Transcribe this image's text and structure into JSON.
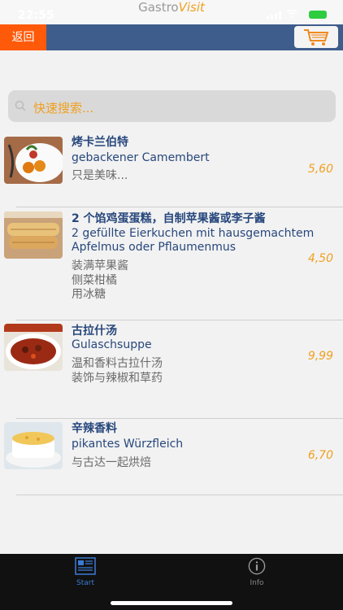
{
  "status_bar": {
    "time": "22:55",
    "brand_part1": "Gastro",
    "brand_part2": "Visit"
  },
  "nav": {
    "back_label": "返回",
    "cart_icon": "shopping-cart-icon"
  },
  "search": {
    "placeholder": "快速搜索..."
  },
  "menu": {
    "items": [
      {
        "name": "烤卡兰伯特",
        "subtitle": "gebackener Camembert",
        "desc1": "只是美味...",
        "desc2": "",
        "desc3": "",
        "price": "5,60"
      },
      {
        "name": "2 个馅鸡蛋蛋糕，自制苹果酱或李子酱",
        "subtitle": "2 gefüllte Eierkuchen mit hausgemachtem Apfelmus oder Pflaumenmus",
        "desc1": "装满苹果酱",
        "desc2": "侧菜柑橘",
        "desc3": "用冰糖",
        "price": "4,50"
      },
      {
        "name": "古拉什汤",
        "subtitle": "Gulaschsuppe",
        "desc1": "温和香料古拉什汤",
        "desc2": "装饰与辣椒和草药",
        "desc3": "",
        "price": "9,99"
      },
      {
        "name": "辛辣香料",
        "subtitle": "pikantes Würzfleich",
        "desc1": "与古达一起烘焙",
        "desc2": "",
        "desc3": "",
        "price": "6,70"
      }
    ]
  },
  "tabs": [
    {
      "label": "Start",
      "icon": "menu-card-icon",
      "color": "#3a7bd5"
    },
    {
      "label": "Info",
      "icon": "info-icon",
      "color": "#8a8a8a"
    }
  ]
}
